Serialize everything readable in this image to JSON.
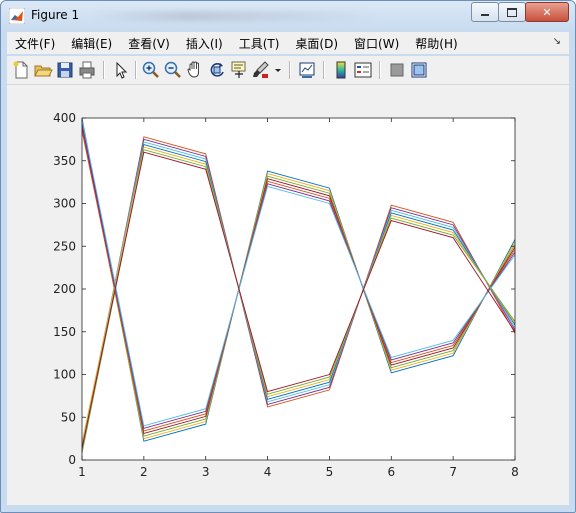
{
  "window": {
    "title": "Figure 1",
    "buttons": {
      "minimize": "▭",
      "maximize": "□",
      "close": "✕"
    }
  },
  "menu": {
    "items": [
      "文件(F)",
      "编辑(E)",
      "查看(V)",
      "插入(I)",
      "工具(T)",
      "桌面(D)",
      "窗口(W)",
      "帮助(H)"
    ],
    "overflow_icon": "dock-arrow-icon"
  },
  "toolbar": {
    "icons": [
      "new-figure-icon",
      "open-file-icon",
      "save-icon",
      "print-icon",
      "edit-plot-arrow-icon",
      "zoom-in-icon",
      "zoom-out-icon",
      "pan-hand-icon",
      "rotate-3d-icon",
      "data-cursor-icon",
      "brush-icon",
      "brush-dropdown-icon",
      "link-plot-icon",
      "colorbar-icon",
      "legend-icon",
      "hide-plot-tools-icon",
      "show-plot-tools-icon"
    ]
  },
  "colors": {
    "series": [
      "#0072bd",
      "#d95319",
      "#edb120",
      "#7e2f8e",
      "#77ac30",
      "#4dbeee",
      "#a2142f",
      "#0072bd",
      "#d95319",
      "#edb120",
      "#7e2f8e",
      "#77ac30",
      "#4dbeee",
      "#a2142f"
    ],
    "axes_background": "#ffffff",
    "figure_background": "#f0f0f0"
  },
  "chart_data": {
    "type": "line",
    "xlim": [
      1,
      8
    ],
    "ylim": [
      0,
      400
    ],
    "xticks": [
      "1",
      "2",
      "3",
      "4",
      "5",
      "6",
      "7",
      "8"
    ],
    "yticks": [
      "0",
      "50",
      "100",
      "150",
      "200",
      "250",
      "300",
      "350",
      "400"
    ],
    "grid": false,
    "title": "",
    "xlabel": "",
    "ylabel": "",
    "x": [
      1,
      2,
      3,
      4,
      5,
      6,
      7,
      8
    ],
    "series": [
      {
        "values": [
          400,
          22,
          42,
          338,
          318,
          102,
          122,
          258
        ]
      },
      {
        "values": [
          12,
          378,
          358,
          62,
          82,
          298,
          278,
          148
        ]
      },
      {
        "values": [
          392,
          25,
          45,
          335,
          315,
          105,
          125,
          255
        ]
      },
      {
        "values": [
          15,
          375,
          355,
          65,
          85,
          295,
          275,
          152
        ]
      },
      {
        "values": [
          388,
          28,
          48,
          332,
          312,
          108,
          128,
          252
        ]
      },
      {
        "values": [
          18,
          372,
          352,
          68,
          88,
          292,
          272,
          155
        ]
      },
      {
        "values": [
          395,
          31,
          51,
          329,
          309,
          111,
          131,
          249
        ]
      },
      {
        "values": [
          10,
          369,
          349,
          71,
          91,
          289,
          269,
          158
        ]
      },
      {
        "values": [
          385,
          34,
          54,
          326,
          306,
          114,
          134,
          246
        ]
      },
      {
        "values": [
          20,
          366,
          346,
          74,
          94,
          286,
          266,
          160
        ]
      },
      {
        "values": [
          390,
          37,
          57,
          323,
          303,
          117,
          137,
          243
        ]
      },
      {
        "values": [
          8,
          363,
          343,
          77,
          97,
          283,
          263,
          162
        ]
      },
      {
        "values": [
          398,
          40,
          60,
          320,
          300,
          120,
          140,
          240
        ]
      },
      {
        "values": [
          14,
          360,
          340,
          80,
          100,
          280,
          260,
          150
        ]
      }
    ]
  }
}
